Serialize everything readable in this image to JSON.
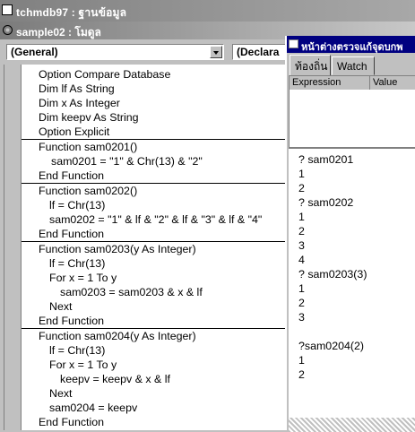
{
  "window_title": "tchmdb97 : ฐานข้อมูล",
  "module_title": "sample02 : โมดูล",
  "object_combo": "(General)",
  "proc_combo": "(Declara",
  "immediate_title": "หน้าต่างตรวจแก้จุดบกพ",
  "tabs": {
    "locals": "ท้องถิ่น",
    "watch": "Watch"
  },
  "watch_headers": {
    "expression": "Expression",
    "value": "Value"
  },
  "code": [
    "Option Compare Database",
    "Dim lf As String",
    "Dim x As Integer",
    "Dim keepv As String",
    "Option Explicit",
    "Function sam0201()",
    "sam0201 = \"1\" & Chr(13) & \"2\"",
    "End Function",
    "Function sam0202()",
    "lf = Chr(13)",
    "sam0202 = \"1\" & lf & \"2\" & lf & \"3\" & lf & \"4\"",
    "End Function",
    "Function sam0203(y As Integer)",
    "lf = Chr(13)",
    "For x = 1 To y",
    "sam0203 = sam0203 & x & lf",
    "Next",
    "End Function",
    "Function sam0204(y As Integer)",
    "lf = Chr(13)",
    "For x = 1 To y",
    "keepv = keepv & x & lf",
    "Next",
    "sam0204 = keepv",
    "End Function"
  ],
  "immediate_output": [
    "? sam0201",
    "1",
    "2",
    "? sam0202",
    "1",
    "2",
    "3",
    "4",
    "? sam0203(3)",
    "1",
    "2",
    "3",
    "",
    "?sam0204(2)",
    "1",
    "2"
  ]
}
